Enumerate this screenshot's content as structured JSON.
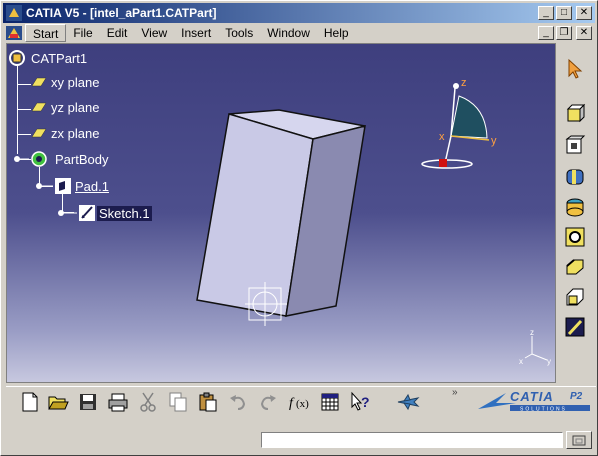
{
  "window": {
    "title": "CATIA V5 - [intel_aPart1.CATPart]",
    "min_label": "_",
    "max_label": "□",
    "close_label": "✕"
  },
  "menu": {
    "items": [
      "Start",
      "File",
      "Edit",
      "View",
      "Insert",
      "Tools",
      "Window",
      "Help"
    ]
  },
  "tree": {
    "root": "CATPart1",
    "planes": [
      "xy plane",
      "yz plane",
      "zx plane"
    ],
    "body": "PartBody",
    "feature": "Pad.1",
    "sketch": "Sketch.1"
  },
  "compass": {
    "x": "x",
    "y": "y",
    "z": "z"
  },
  "axis_triad": {
    "z": "z",
    "x": "x",
    "y": "y"
  },
  "logo": {
    "brand": "CATIA",
    "edition": "P2",
    "tagline": "SOLUTIONS"
  },
  "colors": {
    "viewport_top": "#3e3f7e",
    "viewport_bottom": "#c7c8df",
    "pad_face": "#c9c9e6",
    "title_bar": "#0a246a"
  },
  "status": {
    "text": ""
  },
  "toolbar_icons": [
    "new-icon",
    "open-icon",
    "save-icon",
    "print-icon",
    "cut-icon",
    "copy-icon",
    "paste-icon",
    "undo-icon",
    "redo-icon",
    "formula-icon",
    "table-icon",
    "whats-this-icon",
    "fly-mode-icon"
  ]
}
